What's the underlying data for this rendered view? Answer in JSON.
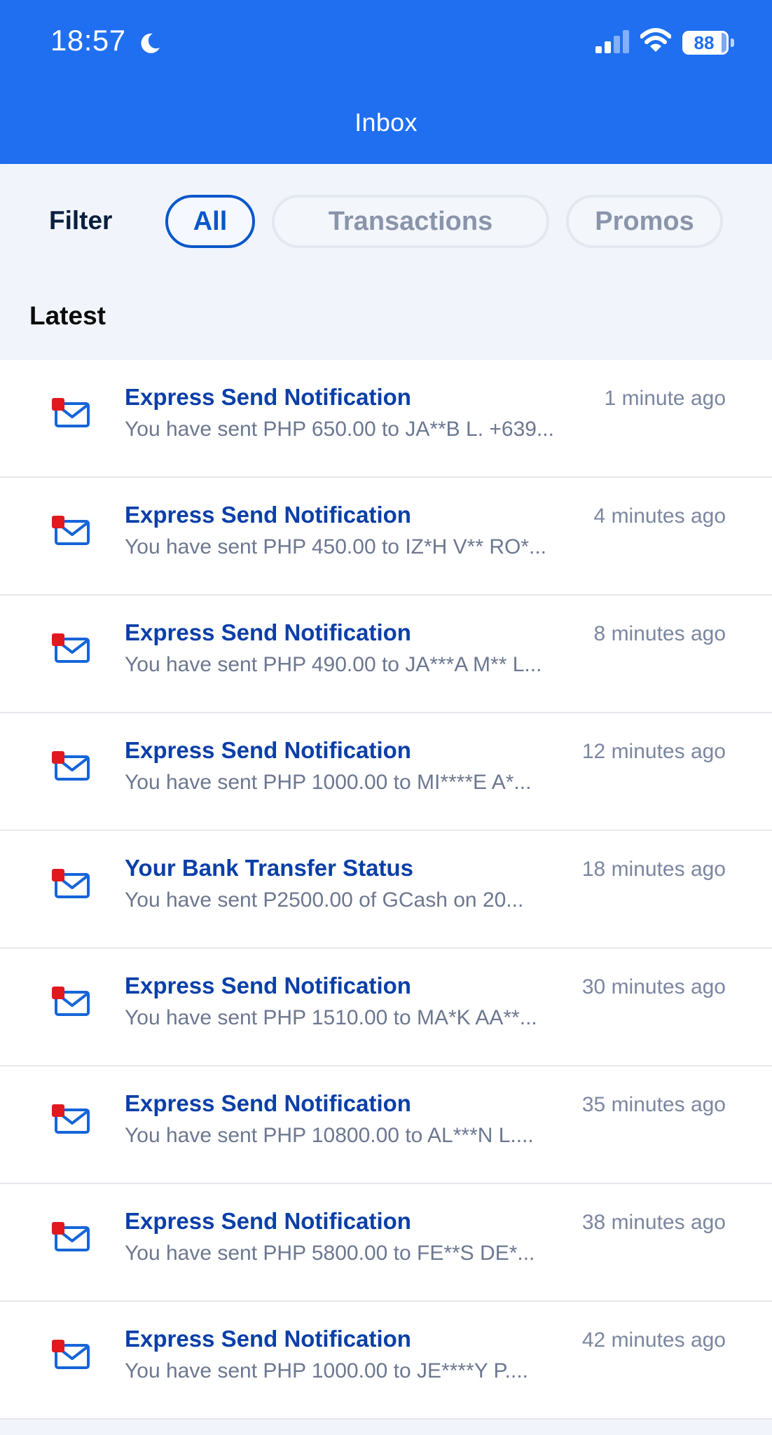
{
  "status_bar": {
    "time": "18:57",
    "battery": "88",
    "battery_level": 0.88,
    "icons": [
      "moon-icon",
      "signal-icon",
      "wifi-icon",
      "battery-icon"
    ]
  },
  "header": {
    "title": "Inbox"
  },
  "filter": {
    "label": "Filter",
    "chips": [
      {
        "label": "All",
        "selected": true
      },
      {
        "label": "Transactions",
        "selected": false
      },
      {
        "label": "Promos",
        "selected": false
      }
    ]
  },
  "section": {
    "title": "Latest"
  },
  "messages": [
    {
      "title": "Express Send Notification",
      "time": "1 minute ago",
      "body": "You have sent PHP 650.00 to JA**B L. +639...",
      "unread": true
    },
    {
      "title": "Express Send Notification",
      "time": "4 minutes ago",
      "body": "You have sent PHP 450.00 to IZ*H V** RO*...",
      "unread": true
    },
    {
      "title": "Express Send Notification",
      "time": "8 minutes ago",
      "body": "You have sent PHP 490.00 to JA***A M** L...",
      "unread": true
    },
    {
      "title": "Express Send Notification",
      "time": "12 minutes ago",
      "body": "You have sent PHP 1000.00 to MI****E A*...",
      "unread": true
    },
    {
      "title": "Your Bank Transfer Status",
      "time": "18 minutes ago",
      "body": "You have sent P2500.00 of GCash on 20...",
      "unread": true
    },
    {
      "title": "Express Send Notification",
      "time": "30 minutes ago",
      "body": "You have sent PHP 1510.00 to MA*K AA**...",
      "unread": true
    },
    {
      "title": "Express Send Notification",
      "time": "35 minutes ago",
      "body": "You have sent PHP 10800.00 to AL***N L....",
      "unread": true
    },
    {
      "title": "Express Send Notification",
      "time": "38 minutes ago",
      "body": "You have sent PHP 5800.00 to FE**S DE*...",
      "unread": true
    },
    {
      "title": "Express Send Notification",
      "time": "42 minutes ago",
      "body": "You have sent PHP 1000.00 to JE****Y P....",
      "unread": true
    }
  ],
  "colors": {
    "brand": "#1f6ff0",
    "title_text": "#0b3fa8",
    "unread_dot": "#e0191f",
    "selected_chip": "#0a57c9"
  }
}
